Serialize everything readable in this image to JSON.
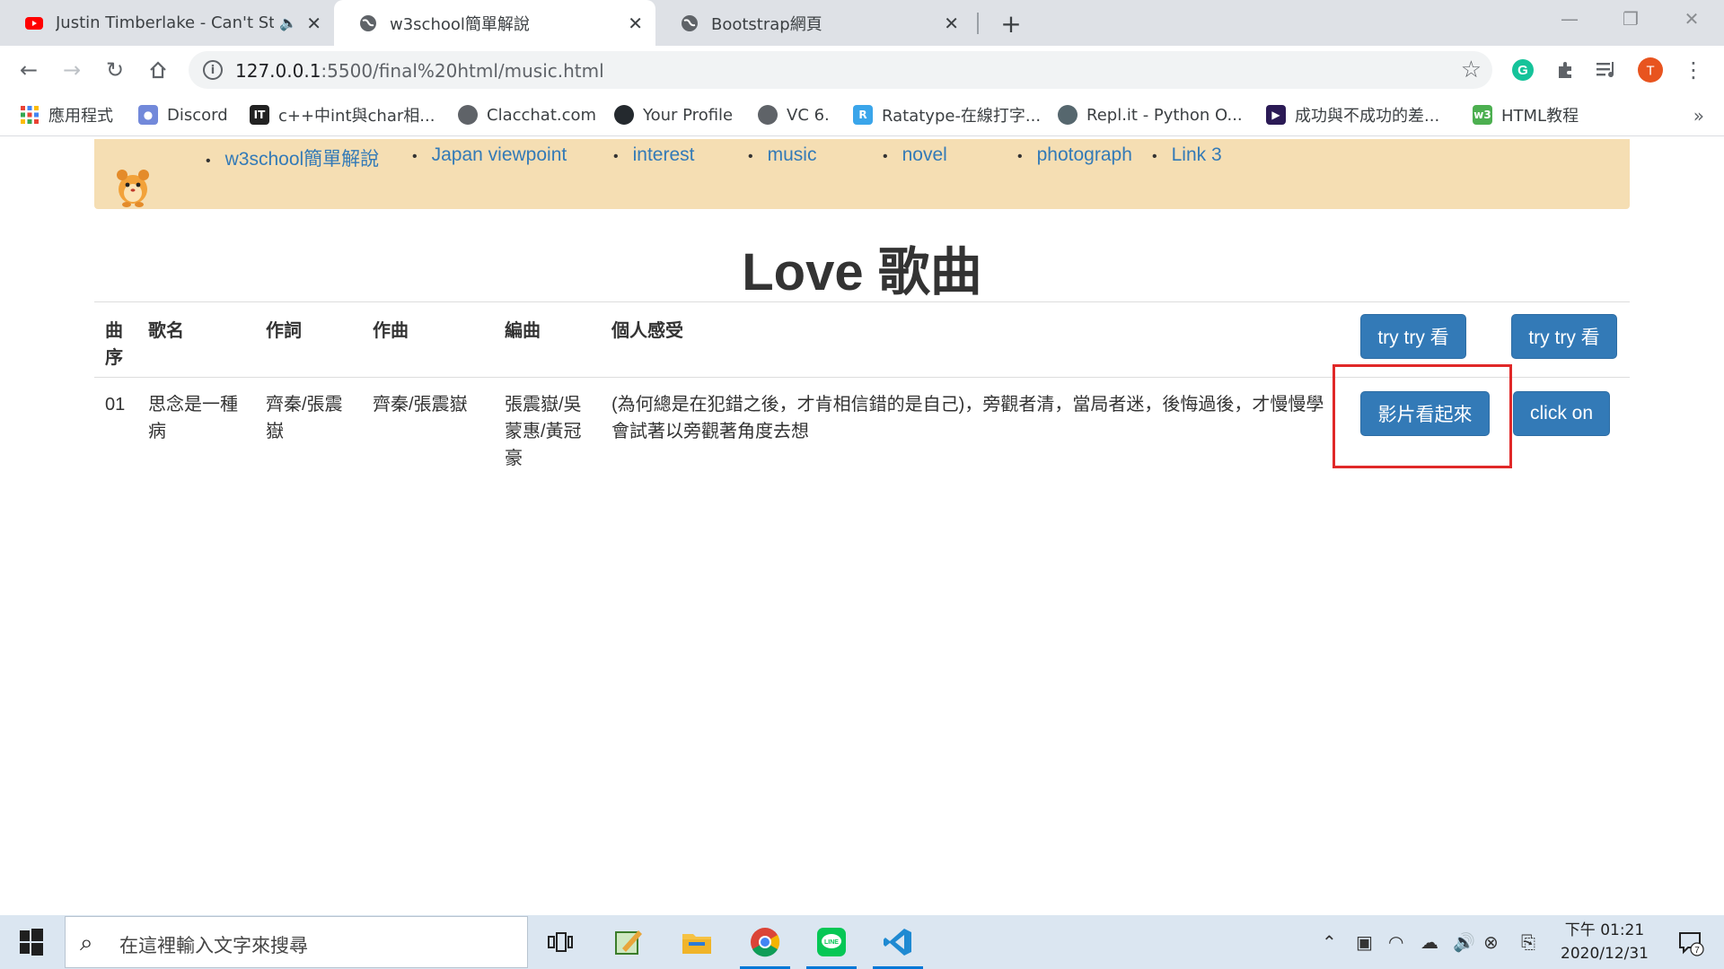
{
  "browser": {
    "tabs": [
      {
        "title": "Justin Timberlake - Can't St",
        "icon": "youtube-icon",
        "muted": true
      },
      {
        "title": "w3school簡單解說",
        "icon": "globe-icon",
        "active": true
      },
      {
        "title": "Bootstrap網頁",
        "icon": "globe-icon"
      }
    ],
    "url_host": "127.0.0.1",
    "url_rest": ":5500/final%20html/music.html",
    "profile_initial": "T",
    "bookmarks": [
      {
        "label": "應用程式",
        "icon": "apps-grid-icon"
      },
      {
        "label": "Discord",
        "icon": "discord-icon"
      },
      {
        "label": "c++中int與char相...",
        "icon": "ithome-icon"
      },
      {
        "label": "Clacchat.com",
        "icon": "globe-icon"
      },
      {
        "label": "Your Profile",
        "icon": "github-icon"
      },
      {
        "label": "VC 6.",
        "icon": "globe-icon"
      },
      {
        "label": "Ratatype-在線打字...",
        "icon": "ratatype-icon"
      },
      {
        "label": "Repl.it - Python O...",
        "icon": "replit-icon"
      },
      {
        "label": "成功與不成功的差...",
        "icon": "play-icon"
      },
      {
        "label": "HTML教程",
        "icon": "w3-icon"
      }
    ]
  },
  "page": {
    "nav_links": [
      "w3school簡單解說",
      "Japan viewpoint",
      "interest",
      "music",
      "novel",
      "photograph",
      "Link 3"
    ],
    "heading": "Love 歌曲",
    "table": {
      "headers": [
        "曲序",
        "歌名",
        "作詞",
        "作曲",
        "編曲",
        "個人感受"
      ],
      "header_buttons": [
        "try try 看",
        "try try 看"
      ],
      "rows": [
        {
          "no": "01",
          "name": "思念是一種病",
          "lyrics": "齊秦/張震嶽",
          "composer": "齊秦/張震嶽",
          "arranger": "張震嶽/吳蒙惠/黃冠豪",
          "feeling": "(為何總是在犯錯之後，才肯相信錯的是自己)，旁觀者清，當局者迷，後悔過後，才慢慢學會試著以旁觀著角度去想",
          "buttons": [
            "影片看起來",
            "click on"
          ]
        }
      ]
    }
  },
  "taskbar": {
    "search_placeholder": "在這裡輸入文字來搜尋",
    "time": "下午 01:21",
    "date": "2020/12/31",
    "notification_count": "7"
  },
  "colors": {
    "accent_button": "#337ab7",
    "nav_bg": "#f5deb3",
    "highlight_box": "#e02828"
  }
}
